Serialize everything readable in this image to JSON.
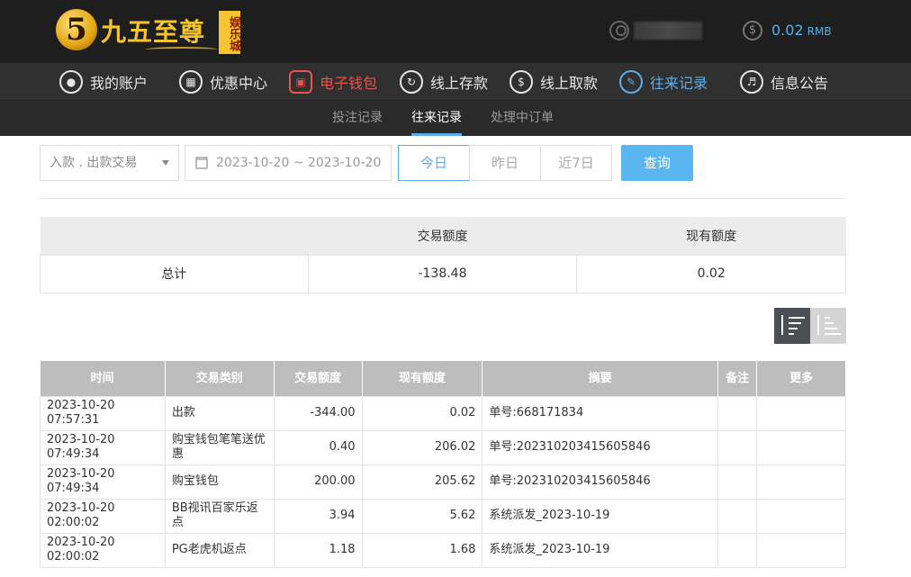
{
  "brand": {
    "name": "九五至尊",
    "badge": "娱乐城",
    "numeral": "5"
  },
  "account": {
    "balance": "0.02",
    "currency": "RMB"
  },
  "nav": [
    {
      "label": "我的账户",
      "icon": "user-circle-icon"
    },
    {
      "label": "优惠中心",
      "icon": "gift-icon"
    },
    {
      "label": "电子钱包",
      "icon": "wallet-icon"
    },
    {
      "label": "线上存款",
      "icon": "deposit-icon"
    },
    {
      "label": "线上取款",
      "icon": "withdraw-icon"
    },
    {
      "label": "往来记录",
      "icon": "records-icon"
    },
    {
      "label": "信息公告",
      "icon": "bell-icon"
    }
  ],
  "subnav": [
    "投注记录",
    "往来记录",
    "处理中订单"
  ],
  "filters": {
    "type": "入款 . 出款交易",
    "date_range": "2023-10-20 ~ 2023-10-20",
    "days": [
      "今日",
      "昨日",
      "近7日"
    ],
    "query": "查询"
  },
  "summary": {
    "headers": [
      "",
      "交易额度",
      "现有额度"
    ],
    "row": [
      "总计",
      "-138.48",
      "0.02"
    ]
  },
  "table": {
    "headers": [
      "时间",
      "交易类别",
      "交易额度",
      "现有额度",
      "摘要",
      "备注",
      "更多"
    ],
    "rows": [
      [
        "2023-10-20 07:57:31",
        "出款",
        "-344.00",
        "0.02",
        "单号:668171834",
        "",
        ""
      ],
      [
        "2023-10-20 07:49:34",
        "购宝钱包笔笔送优惠",
        "0.40",
        "206.02",
        "单号:202310203415605846",
        "",
        ""
      ],
      [
        "2023-10-20 07:49:34",
        "购宝钱包",
        "200.00",
        "205.62",
        "单号:202310203415605846",
        "",
        ""
      ],
      [
        "2023-10-20 02:00:02",
        "BB视讯百家乐返点",
        "3.94",
        "5.62",
        "系统派发_2023-10-19",
        "",
        ""
      ],
      [
        "2023-10-20 02:00:02",
        "PG老虎机返点",
        "1.18",
        "1.68",
        "系统派发_2023-10-19",
        "",
        ""
      ]
    ]
  },
  "colors": {
    "accent": "#5aaee8",
    "active_red": "#e8544e",
    "gold": "#f4c431"
  }
}
